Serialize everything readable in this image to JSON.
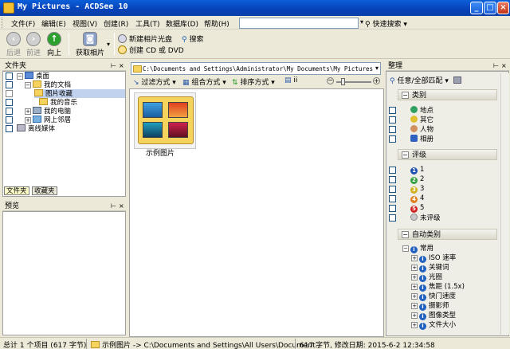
{
  "window": {
    "title": "My Pictures - ACDSee 10"
  },
  "menu": [
    "文件(F)",
    "编辑(E)",
    "视图(V)",
    "创建(R)",
    "工具(T)",
    "数据库(D)",
    "帮助(H)"
  ],
  "quick_search": "快速搜索",
  "toolbar": {
    "back": "后退",
    "forward": "前进",
    "up": "向上",
    "acquire": "获取相片",
    "new_disc": "新建相片光盘",
    "search": "搜索",
    "create_cd": "创建 CD 或 DVD"
  },
  "folders_pane": {
    "title": "文件夹",
    "tree": [
      "桌面",
      "我的文档",
      "图片收藏",
      "我的音乐",
      "我的电脑",
      "网上邻居",
      "离线媒体"
    ],
    "tabs": [
      "文件夹",
      "收藏夹"
    ]
  },
  "preview_pane": {
    "title": "预览"
  },
  "center": {
    "path": "C:\\Documents and Settings\\Administrator\\My Documents\\My Pictures",
    "filter": "过滤方式",
    "group": "组合方式",
    "sort": "排序方式",
    "view_short": "ii",
    "thumb_label": "示例图片"
  },
  "organize": {
    "title": "整理",
    "match": "任意/全部匹配",
    "categories_header": "类别",
    "categories": [
      "地点",
      "其它",
      "人物",
      "相册"
    ],
    "ratings_header": "评级",
    "ratings": [
      "1",
      "2",
      "3",
      "4",
      "5",
      "未评级"
    ],
    "auto_header": "自动类别",
    "auto_root": "常用",
    "auto_items": [
      "ISO 速率",
      "关键词",
      "光圈",
      "焦距 (1.5x)",
      "快门速度",
      "摄影师",
      "图像类型",
      "文件大小"
    ]
  },
  "status": {
    "total": "总计 1 个项目 (617 字节)",
    "item": "示例图片 -> C:\\Documents and Settings\\All Users\\Document...",
    "detail": "617 字节, 修改日期: 2015-6-2 12:34:58"
  },
  "colors": {
    "title_blue": "#0842b8",
    "accent_selection": "#c1d2ee",
    "tab_active": "#ffffcc"
  }
}
